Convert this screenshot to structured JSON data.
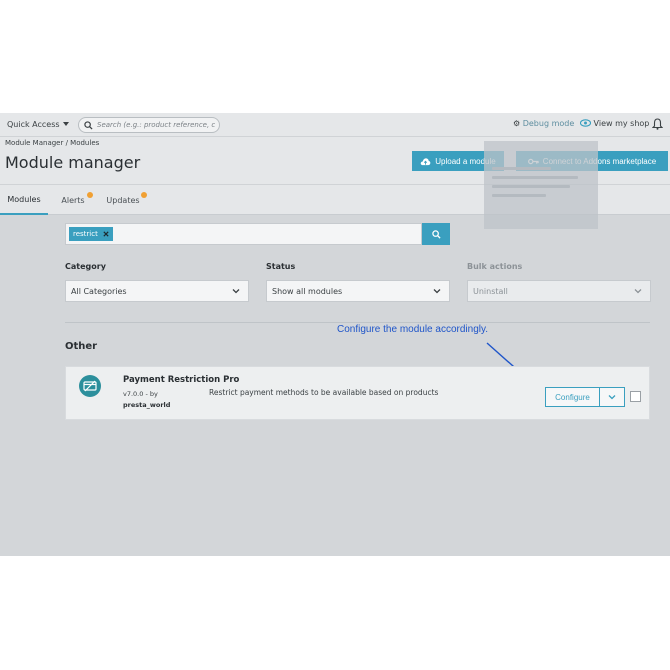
{
  "topbar": {
    "quick_access": "Quick Access",
    "search_placeholder": "Search (e.g.: product reference, custome",
    "debug_mode": "Debug mode",
    "view_shop": "View my shop"
  },
  "header": {
    "breadcrumb": "Module Manager  /  Modules",
    "title": "Module manager",
    "upload_btn": "Upload a module",
    "connect_btn": "Connect to Addons marketplace"
  },
  "tabs": [
    {
      "label": "Modules",
      "active": true
    },
    {
      "label": "Alerts",
      "has_notification": true
    },
    {
      "label": "Updates",
      "has_notification": true
    }
  ],
  "filters": {
    "search_tag": "restrict",
    "category_label": "Category",
    "category_value": "All Categories",
    "status_label": "Status",
    "status_value": "Show all modules",
    "bulk_label": "Bulk actions",
    "bulk_value": "Uninstall"
  },
  "annotation": "Configure the module accordingly.",
  "section": {
    "title": "Other"
  },
  "module": {
    "name": "Payment Restriction Pro",
    "version": "v7.0.0 - by",
    "author": "presta_world",
    "description": "Restrict payment methods to be available based on products",
    "configure": "Configure"
  },
  "colors": {
    "accent": "#3a9fbf",
    "annotation": "#1f55c9",
    "notification": "#f0a033",
    "logo": "#2c8f9c"
  }
}
